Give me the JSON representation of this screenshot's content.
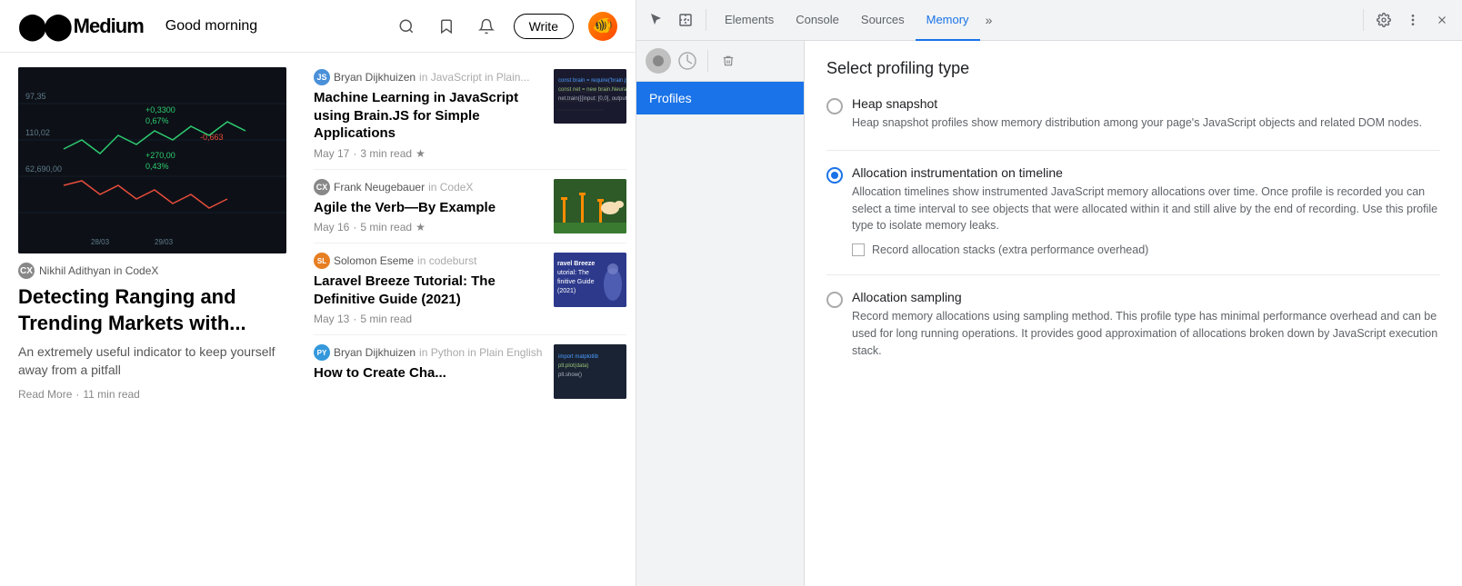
{
  "medium": {
    "logo_icon": "⬤⬤",
    "logo_text": "Medium",
    "greeting": "Good morning",
    "write_btn": "Write",
    "featured": {
      "source_initial": "CX",
      "author": "Nikhil Adithyan in CodeX",
      "title": "Detecting Ranging and Trending Markets with...",
      "subtitle": "An extremely useful indicator to keep yourself away from a pitfall",
      "read_more": "Read More",
      "read_time": "11 min read"
    },
    "articles": [
      {
        "author_initial": "JS",
        "author_color": "#4a90d9",
        "author": "Bryan Dijkhuizen",
        "publication": "in JavaScript in Plain...",
        "title": "Machine Learning in JavaScript using Brain.JS for Simple Applications",
        "date": "May 17",
        "read_time": "3 min read",
        "starred": true,
        "thumb_type": "code_dark"
      },
      {
        "author_initial": "CX",
        "author_color": "#888",
        "author": "Frank Neugebauer",
        "publication": "in CodeX",
        "title": "Agile the Verb—By Example",
        "date": "May 16",
        "read_time": "5 min read",
        "starred": true,
        "thumb_type": "agile_green"
      },
      {
        "author_initial": "SL",
        "author_color": "#e67e22",
        "author": "Solomon Eseme",
        "publication": "in codeburst",
        "title": "Laravel Breeze Tutorial: The Definitive Guide (2021)",
        "date": "May 13",
        "read_time": "5 min read",
        "starred": false,
        "thumb_type": "laravel_blue"
      },
      {
        "author_initial": "PY",
        "author_color": "#3498db",
        "author": "Bryan Dijkhuizen",
        "publication": "in Python in Plain English",
        "title": "How to Create Cha...",
        "date": "",
        "read_time": "",
        "starred": false,
        "thumb_type": "py_dark"
      }
    ]
  },
  "devtools": {
    "tabs": [
      "Elements",
      "Console",
      "Sources",
      "Memory"
    ],
    "active_tab": "Memory",
    "sidebar": {
      "profiles_label": "Profiles"
    },
    "memory": {
      "title": "Select profiling type",
      "options": [
        {
          "id": "heap",
          "label": "Heap snapshot",
          "desc": "Heap snapshot profiles show memory distribution among your page's JavaScript objects and related DOM nodes.",
          "selected": false
        },
        {
          "id": "allocation",
          "label": "Allocation instrumentation on timeline",
          "desc": "Allocation timelines show instrumented JavaScript memory allocations over time. Once profile is recorded you can select a time interval to see objects that were allocated within it and still alive by the end of recording. Use this profile type to isolate memory leaks.",
          "selected": true,
          "sub_checkbox_label": "Record allocation stacks (extra performance overhead)"
        },
        {
          "id": "sampling",
          "label": "Allocation sampling",
          "desc": "Record memory allocations using sampling method. This profile type has minimal performance overhead and can be used for long running operations. It provides good approximation of allocations broken down by JavaScript execution stack.",
          "selected": false
        }
      ]
    }
  }
}
